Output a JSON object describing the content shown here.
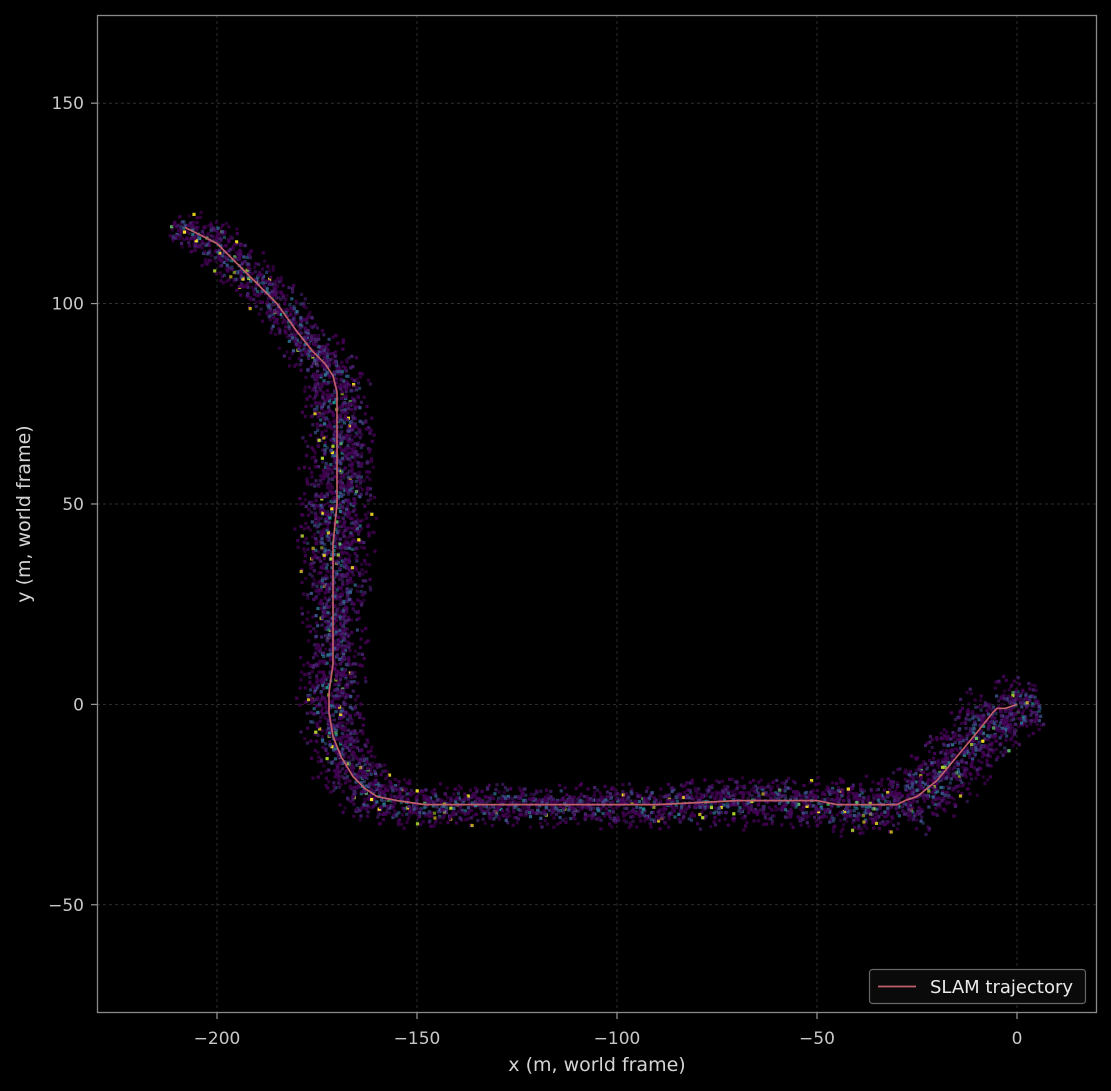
{
  "chart_data": {
    "type": "heatmap",
    "xlabel": "x (m, world frame)",
    "ylabel": "y (m, world frame)",
    "xlim": [
      -230,
      20
    ],
    "ylim": [
      -77,
      172
    ],
    "xticks": [
      -200,
      -150,
      -100,
      -50,
      0
    ],
    "xtick_labels": [
      "−200",
      "−150",
      "−100",
      "−50",
      "0"
    ],
    "yticks": [
      -50,
      0,
      50,
      100,
      150
    ],
    "ytick_labels": [
      "−50",
      "0",
      "50",
      "100",
      "150"
    ],
    "grid": true,
    "legend": {
      "placement": "lower-right",
      "entries": [
        {
          "label": "SLAM trajectory",
          "color": "#c0606a"
        }
      ]
    },
    "colormap": "viridis",
    "background_color": "#000000",
    "series": [
      {
        "name": "SLAM trajectory",
        "color": "#c0606a",
        "x": [
          0,
          -3,
          -5,
          -6,
          -10,
          -15,
          -20,
          -25,
          -28,
          -30,
          -35,
          -40,
          -45,
          -50,
          -60,
          -70,
          -80,
          -90,
          -100,
          -110,
          -120,
          -130,
          -140,
          -148,
          -155,
          -160,
          -163,
          -166,
          -169,
          -171,
          -172,
          -172,
          -171,
          -171,
          -171,
          -171,
          -170,
          -170,
          -170,
          -170,
          -170,
          -171,
          -173,
          -176,
          -180,
          -185,
          -190,
          -195,
          -200,
          -204,
          -208
        ],
        "y": [
          0,
          -1,
          -1,
          -2,
          -7,
          -13,
          -19,
          -23,
          -24,
          -25,
          -25,
          -25,
          -25,
          -24,
          -24,
          -24,
          -24.5,
          -25,
          -25,
          -25,
          -25,
          -25,
          -25,
          -25,
          -24,
          -23,
          -21,
          -18,
          -13,
          -8,
          -2,
          3,
          10,
          20,
          30,
          40,
          50,
          56,
          62,
          70,
          78,
          82,
          85,
          88,
          93,
          100,
          105,
          110,
          115,
          117,
          119
        ]
      }
    ],
    "density_band": {
      "center_x": [
        5,
        -5,
        -10,
        -15,
        -20,
        -25,
        -28,
        -30,
        -35,
        -40,
        -45,
        -50,
        -60,
        -70,
        -80,
        -90,
        -100,
        -110,
        -120,
        -130,
        -140,
        -148,
        -155,
        -160,
        -163,
        -166,
        -169,
        -171,
        -172,
        -172,
        -171,
        -171,
        -171,
        -171,
        -170,
        -170,
        -170,
        -170,
        -170,
        -171,
        -173,
        -176,
        -180,
        -185,
        -190,
        -195,
        -200,
        -205,
        -212
      ],
      "center_y": [
        0,
        -2,
        -7,
        -13,
        -19,
        -23,
        -24,
        -25,
        -25,
        -25,
        -25,
        -24,
        -24,
        -24,
        -24.5,
        -25,
        -25,
        -25,
        -25,
        -25,
        -25,
        -25,
        -24,
        -23,
        -21,
        -18,
        -13,
        -8,
        -2,
        3,
        10,
        20,
        30,
        40,
        50,
        56,
        62,
        70,
        78,
        82,
        85,
        88,
        93,
        100,
        105,
        110,
        115,
        118,
        120
      ],
      "half_width": [
        8,
        10,
        10,
        10,
        10,
        10,
        9,
        8,
        8,
        8,
        8,
        7,
        7,
        7,
        7,
        6,
        6,
        6,
        6,
        6,
        6,
        6,
        7,
        8,
        9,
        9,
        9,
        9,
        9,
        9,
        9,
        9,
        10,
        11,
        11,
        10,
        10,
        10,
        9,
        9,
        8,
        8,
        7,
        7,
        7,
        7,
        7,
        6,
        4
      ]
    }
  }
}
